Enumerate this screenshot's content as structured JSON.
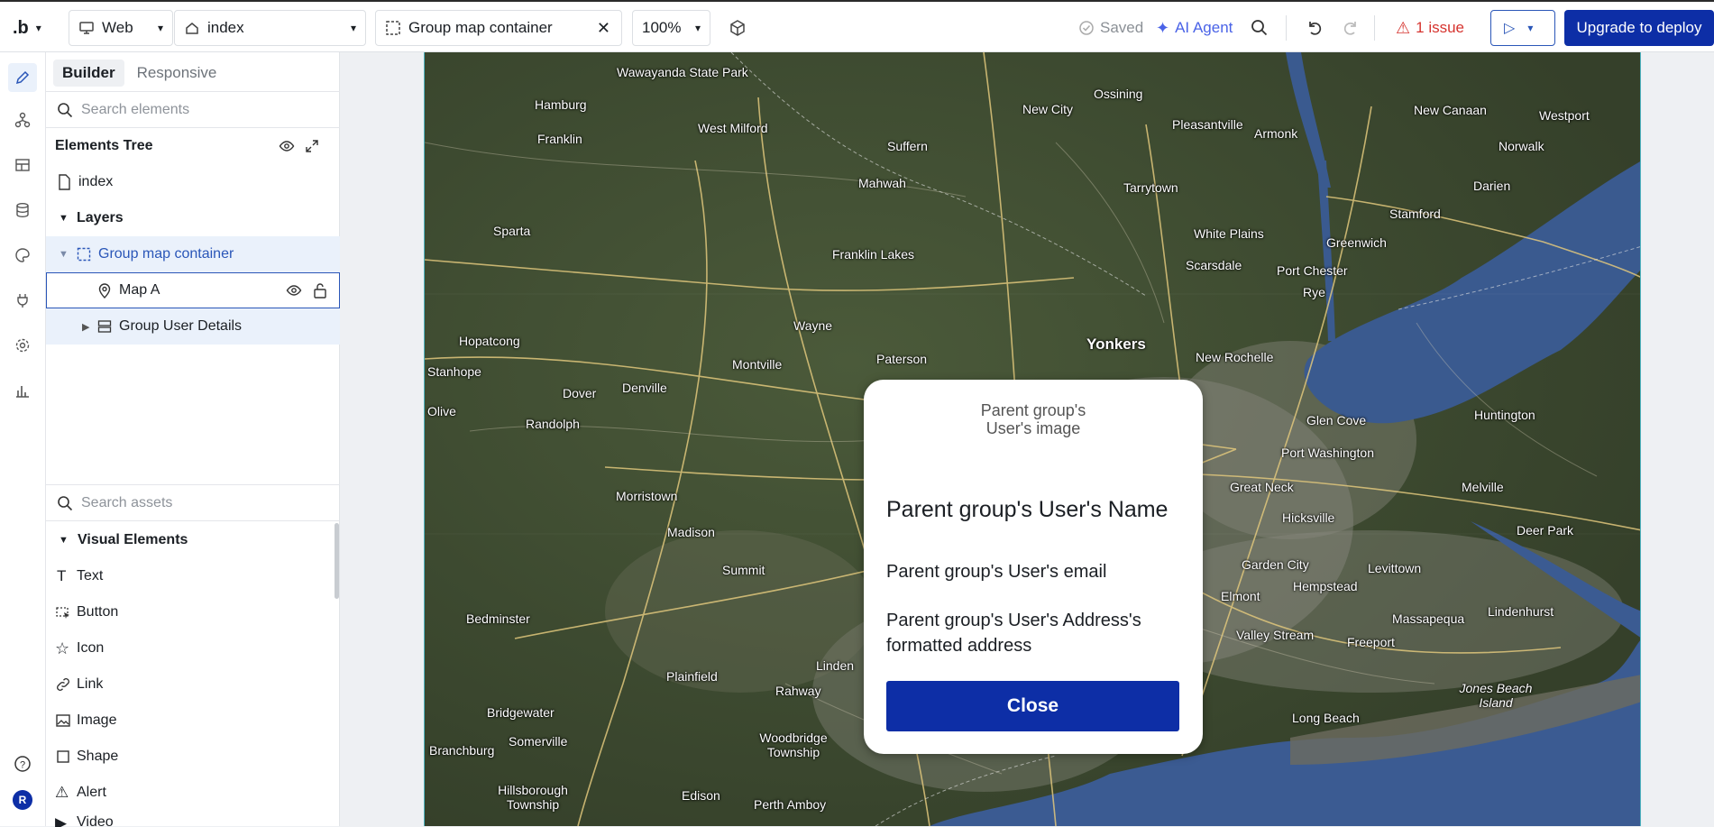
{
  "topbar": {
    "logo": ".b",
    "platform": "Web",
    "page": "index",
    "element": "Group map container",
    "zoom": "100%",
    "saved": "Saved",
    "ai_agent": "AI Agent",
    "issues": "1 issue",
    "deploy": "Upgrade to deploy"
  },
  "rail": {
    "avatar": "R"
  },
  "panel": {
    "tabs": [
      "Builder",
      "Responsive"
    ],
    "search_placeholder": "Search elements",
    "tree_title": "Elements Tree",
    "page": "index",
    "layers": "Layers",
    "tree": [
      {
        "label": "Group map container"
      },
      {
        "label": "Map A"
      },
      {
        "label": "Group User Details"
      }
    ],
    "assets_placeholder": "Search assets",
    "visual_title": "Visual Elements",
    "visual_items": [
      "Text",
      "Button",
      "Icon",
      "Link",
      "Image",
      "Shape",
      "Alert",
      "Video"
    ]
  },
  "map": {
    "labels": [
      "Wawayanda State Park",
      "Hamburg",
      "West Milford",
      "New City",
      "Ossining",
      "Pleasantville",
      "Armonk",
      "New Canaan",
      "Westport",
      "Norwalk",
      "Franklin",
      "Suffern",
      "Mahwah",
      "Tarrytown",
      "Stamford",
      "Darien",
      "Sparta",
      "Franklin Lakes",
      "White Plains",
      "Greenwich",
      "Scarsdale",
      "Port Chester",
      "Rye",
      "Wayne",
      "Paterson",
      "Yonkers",
      "New Rochelle",
      "Hopatcong",
      "Montville",
      "Stanhope",
      "Dover",
      "Denville",
      "Olive",
      "Randolph",
      "Glen Cove",
      "Huntington",
      "Port Washington",
      "Great Neck",
      "Morristown",
      "Madison",
      "Melville",
      "Hicksville",
      "Deer Park",
      "Summit",
      "Garden City",
      "Levittown",
      "Elmont",
      "Hempstead",
      "Bedminster",
      "Massapequa",
      "Lindenhurst",
      "Valley Stream",
      "Freeport",
      "Plainfield",
      "Linden",
      "Rahway",
      "Bridgewater",
      "Somerville",
      "Woodbridge Township",
      "Branchburg",
      "Long Beach",
      "Jones Beach Island",
      "Hillsborough Township",
      "Edison",
      "Perth Amboy",
      "Yonkers"
    ]
  },
  "popup": {
    "image_alt": "Parent group's User's image",
    "name": "Parent group's User's Name",
    "email": "Parent group's User's email",
    "address": "Parent group's User's Address's formatted address",
    "close": "Close"
  }
}
